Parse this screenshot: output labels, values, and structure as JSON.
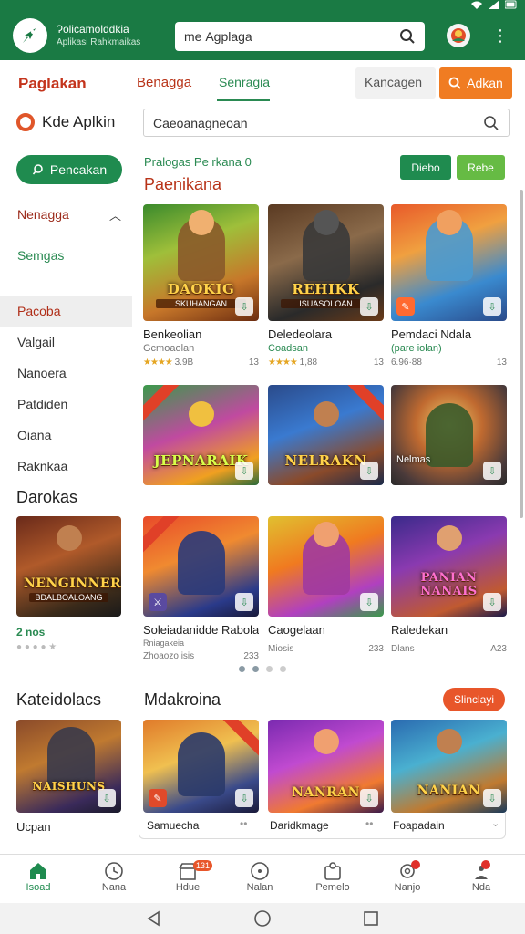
{
  "topbar": {
    "app_name": "Ɂolicamolddkia",
    "app_sub": "Aplikasi Rahkmaikas",
    "search_value": "mе Agplaga",
    "menu_icon": "kebab-icon",
    "brand_color": "#1a7a44"
  },
  "tabrow": {
    "tab1": "Paglakan",
    "tab2": "Benagga",
    "tab3": "Senragia",
    "input_text": "Kancagen",
    "button_label": "Adkan",
    "button_color": "#f07c22"
  },
  "sidebar": {
    "brand": "Kde Aplkin",
    "cta": "Pencakan",
    "items": [
      {
        "label": "Nenagga"
      },
      {
        "label": "Semgas"
      },
      {
        "label": "Pacoba"
      },
      {
        "label": "Valgail"
      },
      {
        "label": "Nanoera"
      },
      {
        "label": "Patdiden"
      },
      {
        "label": "Oiana"
      },
      {
        "label": "Raknkaa"
      }
    ]
  },
  "main": {
    "search_value": "Caeoanagneoan",
    "featured_label": "Pralogas Pe rkana 0",
    "section_title": "Paenikana",
    "pill_a": "Diebo",
    "pill_b": "Rebe"
  },
  "grid1": [
    {
      "title": "Benkeolian",
      "sub": "Gcmoaolan",
      "stars": "★★★★",
      "rating": "3.9B",
      "count": "13",
      "art": "DAOKIG",
      "art_sub": "SKUHANGAN"
    },
    {
      "title": "Deledeolara",
      "sub": "Coadsan",
      "stars": "★★★★",
      "rating": "1,88",
      "count": "13",
      "art": "REHIKK",
      "art_sub": "ISUASOLOAN"
    },
    {
      "title": "Pemdaci Ndala",
      "sub": "(pare iolan)",
      "stars": "",
      "rating": "6.96·88",
      "count": "13",
      "art": "",
      "art_sub": ""
    }
  ],
  "grid2": [
    {
      "art": "JEPNARAIK"
    },
    {
      "art": "NELRAKN"
    },
    {
      "art": "Nelmas"
    }
  ],
  "second_section": {
    "title": "Darokas",
    "left_card": {
      "art": "NENGINNER",
      "art_sub": "BDALBOALOANG",
      "count": "2 nos"
    },
    "cards": [
      {
        "title": "Soleiadanidde Rabola",
        "sub": "Rniagakeia",
        "meta_l": "Zhoaozo isis",
        "meta_r": "233"
      },
      {
        "title": "Caogelaan",
        "sub": "",
        "meta_l": "Miosis",
        "meta_r": "233"
      },
      {
        "title": "Raledekan",
        "sub": "",
        "meta_l": "Dlans",
        "meta_r": "A23"
      }
    ],
    "card3_art": "PANIAN NANAIS"
  },
  "third_section": {
    "title_left": "Kateidolacs",
    "title_right": "Mdakroina",
    "pill": "Slinclayi",
    "left_card": {
      "title": "Ucpan",
      "art": "NAISHUNS"
    },
    "cards": [
      {
        "title": "Samuecha",
        "art": ""
      },
      {
        "title": "Daridkmage",
        "art": "NANRAN"
      },
      {
        "title": "Foapadain",
        "art": "NANIAN"
      }
    ]
  },
  "bottomnav": {
    "items": [
      {
        "label": "Isoad",
        "icon": "home-icon"
      },
      {
        "label": "Nana",
        "icon": "clock-icon"
      },
      {
        "label": "Hdue",
        "icon": "store-icon",
        "badge": "131"
      },
      {
        "label": "Nalan",
        "icon": "target-icon"
      },
      {
        "label": "Pemelo",
        "icon": "profile-icon"
      },
      {
        "label": "Nanjo",
        "icon": "gear-icon"
      },
      {
        "label": "Nda",
        "icon": "user-icon"
      }
    ]
  }
}
